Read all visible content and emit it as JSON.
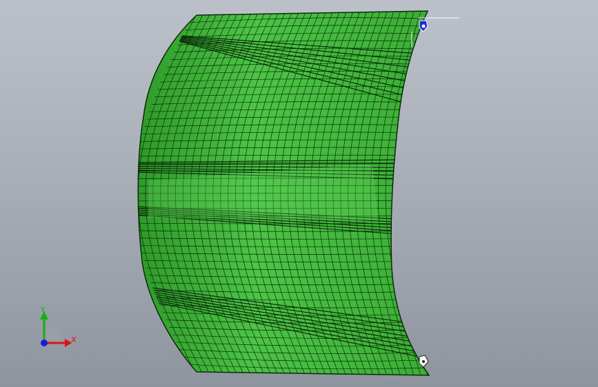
{
  "viewport": {
    "background_top": "#bcc1c9",
    "background_bottom": "#8e959f"
  },
  "model": {
    "mesh_fill": "#3fb63a",
    "mesh_fill_light": "#5fd25a",
    "mesh_line": "#0a2a08"
  },
  "triad": {
    "x_label": "X",
    "y_label": "Y",
    "x_color": "#e01010",
    "y_color": "#10b010",
    "z_color": "#1a1ae0"
  },
  "markers": {
    "top_marker_icon": "coordinate-marker-icon",
    "bottom_marker_icon": "coordinate-marker-icon"
  }
}
